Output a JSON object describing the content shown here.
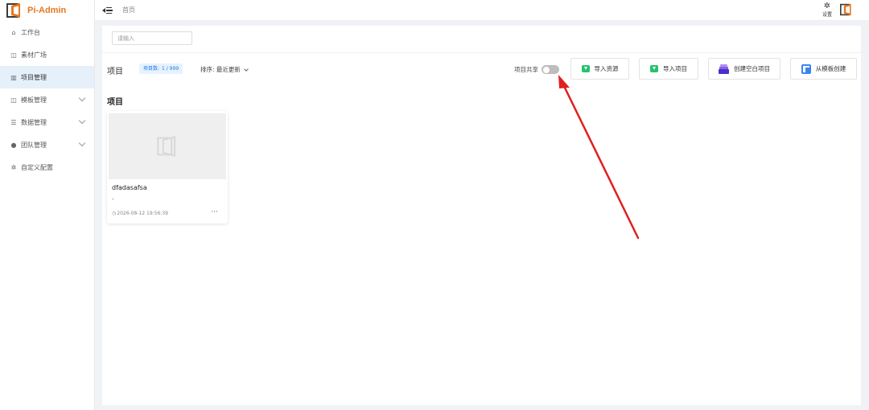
{
  "app": {
    "name": "Pi-Admin",
    "brand_color": "#e8761e"
  },
  "sidebar": {
    "items": [
      {
        "label": "工作台",
        "icon": "home-icon",
        "active": false,
        "expandable": false
      },
      {
        "label": "素材广场",
        "icon": "layout-icon",
        "active": false,
        "expandable": false
      },
      {
        "label": "项目管理",
        "icon": "project-icon",
        "active": true,
        "expandable": false
      },
      {
        "label": "模板管理",
        "icon": "template-icon",
        "active": false,
        "expandable": true
      },
      {
        "label": "数据管理",
        "icon": "database-icon",
        "active": false,
        "expandable": true
      },
      {
        "label": "团队管理",
        "icon": "user-icon",
        "active": false,
        "expandable": true
      },
      {
        "label": "自定义配置",
        "icon": "gear-icon",
        "active": false,
        "expandable": false
      }
    ]
  },
  "header": {
    "breadcrumb": "首页",
    "settings_label": "设置"
  },
  "toolbar": {
    "search_placeholder": "请输入",
    "title": "项目",
    "count_label": "项目数:",
    "count_value": "1 / 999",
    "sort_label": "排序: 最近更新",
    "share_label": "项目共享",
    "share_enabled": false,
    "buttons": [
      {
        "label": "导入资源",
        "icon": "import-icon"
      },
      {
        "label": "导入项目",
        "icon": "import-icon"
      },
      {
        "label": "创建空白项目",
        "icon": "tray-icon"
      },
      {
        "label": "从模板创建",
        "icon": "template-icon"
      }
    ]
  },
  "projects": {
    "section_title": "项目",
    "items": [
      {
        "name": "dfadasafsa",
        "description": "-",
        "updated": "2026-08-12 19:56:39",
        "more": "···"
      }
    ]
  },
  "annotation": {
    "color": "#e02020"
  }
}
